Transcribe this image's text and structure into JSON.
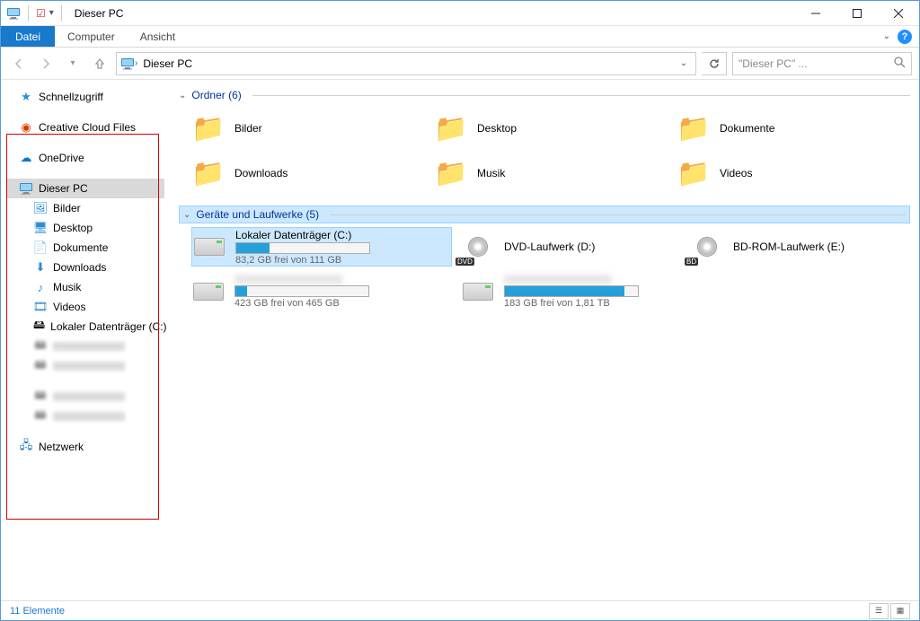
{
  "window": {
    "title": "Dieser PC"
  },
  "ribbon": {
    "tabs": {
      "file": "Datei",
      "computer": "Computer",
      "view": "Ansicht"
    }
  },
  "address": {
    "location": "Dieser PC"
  },
  "search": {
    "placeholder": "\"Dieser PC\" ..."
  },
  "nav": {
    "quickaccess": "Schnellzugriff",
    "ccfiles": "Creative Cloud Files",
    "onedrive": "OneDrive",
    "thispc": "Dieser PC",
    "children": {
      "bilder": "Bilder",
      "desktop": "Desktop",
      "dokumente": "Dokumente",
      "downloads": "Downloads",
      "musik": "Musik",
      "videos": "Videos",
      "localc": "Lokaler Datenträger (C:)"
    },
    "network": "Netzwerk"
  },
  "groups": {
    "folders": {
      "header": "Ordner (6)"
    },
    "drives": {
      "header": "Geräte und Laufwerke (5)"
    }
  },
  "folders": {
    "bilder": "Bilder",
    "desktop": "Desktop",
    "dokumente": "Dokumente",
    "downloads": "Downloads",
    "musik": "Musik",
    "videos": "Videos"
  },
  "drives": {
    "c": {
      "label": "Lokaler Datenträger (C:)",
      "sub": "83,2 GB frei von 111 GB",
      "fill": 25
    },
    "d": {
      "label": "DVD-Laufwerk (D:)"
    },
    "e": {
      "label": "BD-ROM-Laufwerk (E:)"
    },
    "x1": {
      "sub": "423 GB frei von 465 GB",
      "fill": 9
    },
    "x2": {
      "sub": "183 GB frei von 1,81 TB",
      "fill": 90
    }
  },
  "status": {
    "items": "11 Elemente"
  }
}
